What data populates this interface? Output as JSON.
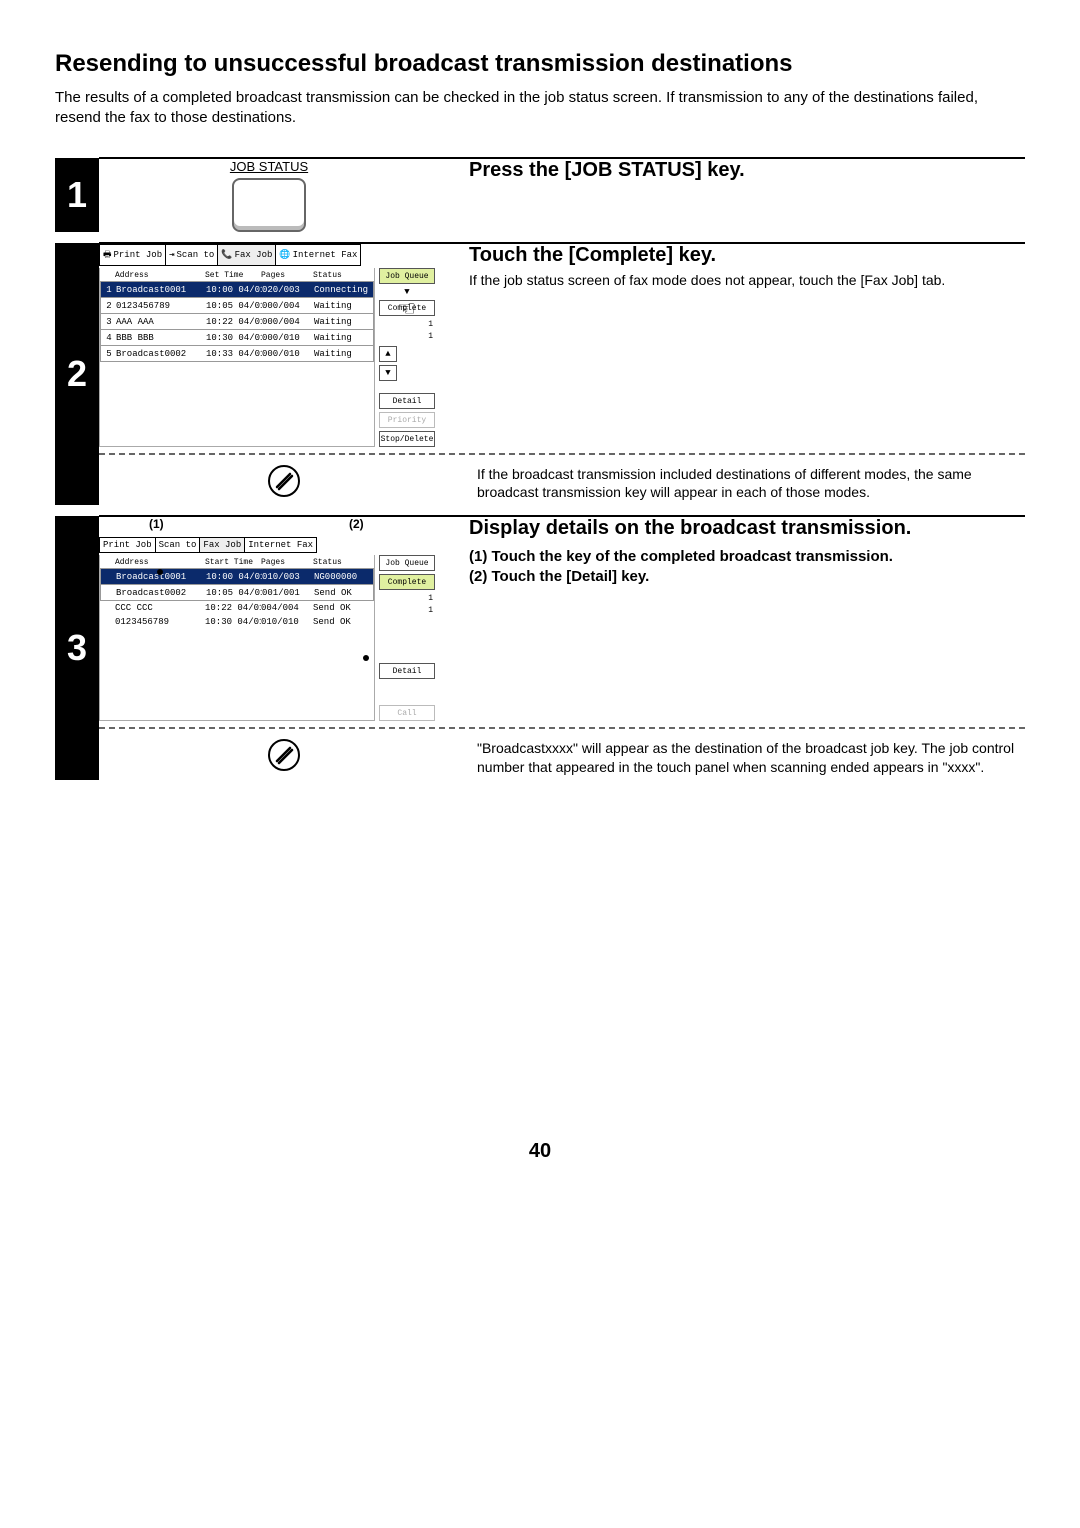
{
  "title": "Resending to unsuccessful broadcast transmission destinations",
  "intro": "The results of a completed broadcast transmission can be checked in the job status screen. If transmission to any of the destinations failed, resend the fax to those destinations.",
  "pageNumber": "40",
  "step1": {
    "num": "1",
    "keyLabel": "JOB STATUS",
    "heading": "Press the [JOB STATUS] key."
  },
  "step2": {
    "num": "2",
    "heading": "Touch the [Complete] key.",
    "body": "If the job status screen of fax mode does not appear, touch the [Fax Job] tab.",
    "note": "If the broadcast transmission included destinations of different modes, the same broadcast transmission key will appear in each of those modes.",
    "tabs": {
      "print": "Print Job",
      "scan": "Scan to",
      "fax": "Fax Job",
      "ifax": "Internet Fax"
    },
    "cols": {
      "addr": "Address",
      "time": "Set Time",
      "pages": "Pages",
      "status": "Status"
    },
    "rows": [
      {
        "n": "1",
        "icon": "👥",
        "addr": "Broadcast0001",
        "time": "10:00 04/01",
        "pages": "020/003",
        "status": "Connecting"
      },
      {
        "n": "2",
        "icon": "📞",
        "addr": "0123456789",
        "time": "10:05 04/01",
        "pages": "000/004",
        "status": "Waiting"
      },
      {
        "n": "3",
        "icon": "📞",
        "addr": "AAA AAA",
        "time": "10:22 04/01",
        "pages": "000/004",
        "status": "Waiting"
      },
      {
        "n": "4",
        "icon": "📞",
        "addr": "BBB BBB",
        "time": "10:30 04/01",
        "pages": "000/010",
        "status": "Waiting"
      },
      {
        "n": "5",
        "icon": "👥",
        "addr": "Broadcast0002",
        "time": "10:33 04/01",
        "pages": "000/010",
        "status": "Waiting"
      }
    ],
    "side": {
      "queue": "Job Queue",
      "complete": "Complete",
      "detail": "Detail",
      "priority": "Priority",
      "stop": "Stop/Delete"
    },
    "scroll": {
      "top": "1",
      "bot": "1"
    }
  },
  "step3": {
    "num": "3",
    "heading": "Display details on the broadcast transmission.",
    "sub1": "(1)  Touch the key of the completed broadcast transmission.",
    "sub2": "(2)  Touch the [Detail] key.",
    "callout1": "(1)",
    "callout2": "(2)",
    "note": "\"Broadcastxxxx\" will appear as the destination of the broadcast job key. The job control number that appeared in the touch panel when scanning ended appears in \"xxxx\".",
    "tabs": {
      "print": "Print Job",
      "scan": "Scan to",
      "fax": "Fax Job",
      "ifax": "Internet Fax"
    },
    "cols": {
      "addr": "Address",
      "time": "Start Time",
      "pages": "Pages",
      "status": "Status"
    },
    "rows": [
      {
        "addr": "Broadcast0001",
        "time": "10:00 04/01",
        "pages": "010/003",
        "status": "NG000000"
      },
      {
        "addr": "Broadcast0002",
        "time": "10:05 04/01",
        "pages": "001/001",
        "status": "Send OK"
      },
      {
        "addr": "CCC CCC",
        "time": "10:22 04/01",
        "pages": "004/004",
        "status": "Send OK"
      },
      {
        "addr": "0123456789",
        "time": "10:30 04/01",
        "pages": "010/010",
        "status": "Send OK"
      }
    ],
    "side": {
      "queue": "Job Queue",
      "complete": "Complete",
      "detail": "Detail",
      "call": "Call"
    },
    "scroll": {
      "top": "1",
      "bot": "1"
    }
  }
}
